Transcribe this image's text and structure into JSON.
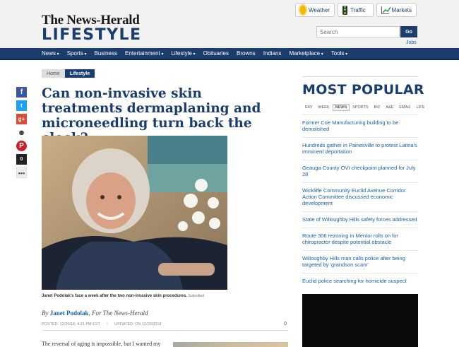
{
  "header": {
    "masthead": "The News-Herald",
    "section": "LIFESTYLE",
    "utility": [
      {
        "label": "Weather",
        "icon": "sun-icon"
      },
      {
        "label": "Traffic",
        "icon": "traffic-light-icon"
      },
      {
        "label": "Markets",
        "icon": "chart-icon"
      }
    ],
    "search_placeholder": "Search",
    "search_button": "Go",
    "jobs_link": "Jobs"
  },
  "nav": [
    {
      "label": "News",
      "dropdown": true
    },
    {
      "label": "Sports",
      "dropdown": true
    },
    {
      "label": "Business",
      "dropdown": false
    },
    {
      "label": "Entertainment",
      "dropdown": true
    },
    {
      "label": "Lifestyle",
      "dropdown": true
    },
    {
      "label": "Obituaries",
      "dropdown": false
    },
    {
      "label": "Browns",
      "dropdown": false
    },
    {
      "label": "Indians",
      "dropdown": false
    },
    {
      "label": "Marketplace",
      "dropdown": true
    },
    {
      "label": "Tools",
      "dropdown": true
    }
  ],
  "breadcrumb": {
    "home": "Home",
    "current": "Lifestyle"
  },
  "share": [
    {
      "label": "f",
      "icon": "facebook-icon"
    },
    {
      "label": "t",
      "icon": "twitter-icon"
    },
    {
      "label": "g+",
      "icon": "google-plus-icon"
    },
    {
      "label": "☻",
      "icon": "reddit-icon"
    },
    {
      "label": "P",
      "icon": "pinterest-icon"
    },
    {
      "label": "0",
      "icon": "comments-icon"
    },
    {
      "label": "•••",
      "icon": "more-icon"
    }
  ],
  "article": {
    "headline": "Can non-invasive skin treatments dermaplaning and microneedling turn back the clock?",
    "caption": "Janet Podolak's face a week after the two non-invasive skin procedures.",
    "caption_credit": "Submitted",
    "byline_prefix": "By",
    "author": "Janet Podolak",
    "byline_suffix": ", For The News-Herald",
    "posted": "POSTED: 12/20/18, 4:21 PM EST",
    "updated": "UPDATED: ON 12/20/2018",
    "comment_count": "0",
    "first_line": "The reversal of aging is impossible, but I wanted my"
  },
  "most_popular": {
    "title": "MOST POPULAR",
    "tabs": [
      "DAY",
      "WEEK",
      "NEWS",
      "SPORTS",
      "BIZ",
      "A&E",
      "EMAIL",
      "LIFE"
    ],
    "active_tab": "NEWS",
    "items": [
      "Former Coe Manufacturing building to be demolished",
      "Hundreds gather in Painesville to protest Latina's imminent deportation",
      "Geauga County OVI checkpoint planned for July 28",
      "Wickliffe Community Euclid Avenue Corridor Action Committee discussed economic development",
      "State of Willoughby Hills safety forces addressed",
      "Route 306 rezoning in Mentor rolls on for chiropractor despite potential obstacle",
      "Willoughby Hills man calls police after being targeted by 'grandson scam'",
      "Euclid police searching for homicide suspect"
    ]
  }
}
